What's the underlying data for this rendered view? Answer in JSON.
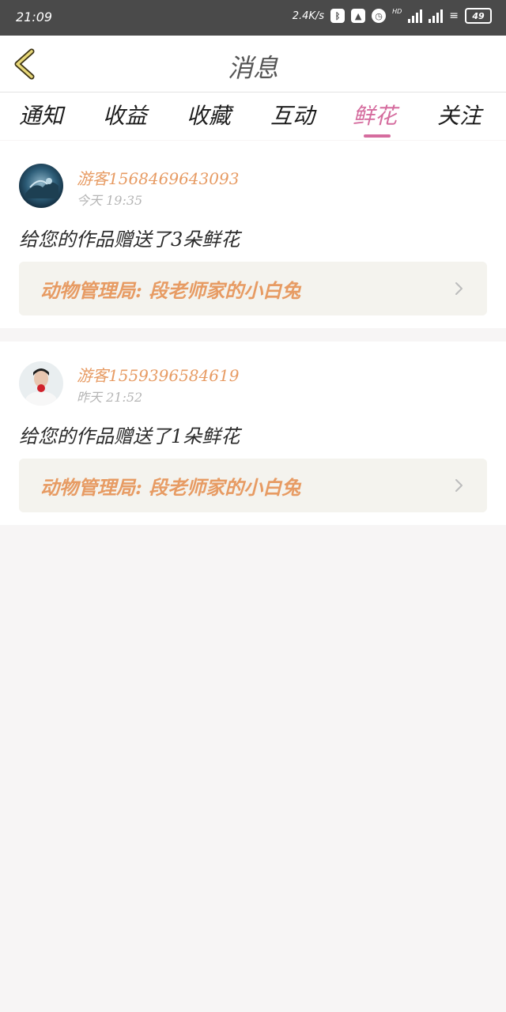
{
  "status_bar": {
    "time": "21:09",
    "speed": "2.4K/s",
    "hd": "HD",
    "battery": "49"
  },
  "header": {
    "title": "消息"
  },
  "tabs": [
    {
      "label": "通知"
    },
    {
      "label": "收益"
    },
    {
      "label": "收藏"
    },
    {
      "label": "互动"
    },
    {
      "label": "鲜花",
      "active": true
    },
    {
      "label": "关注"
    }
  ],
  "messages": [
    {
      "username": "游客1568469643093",
      "time": "今天  19:35",
      "text": "给您的作品赠送了3朵鲜花",
      "work": "动物管理局: 段老师家的小白兔"
    },
    {
      "username": "游客1559396584619",
      "time": "昨天  21:52",
      "text": "给您的作品赠送了1朵鲜花",
      "work": "动物管理局: 段老师家的小白兔"
    }
  ],
  "colors": {
    "accent": "#d56c9e",
    "username": "#e79b63",
    "background": "#f7f5f5"
  }
}
